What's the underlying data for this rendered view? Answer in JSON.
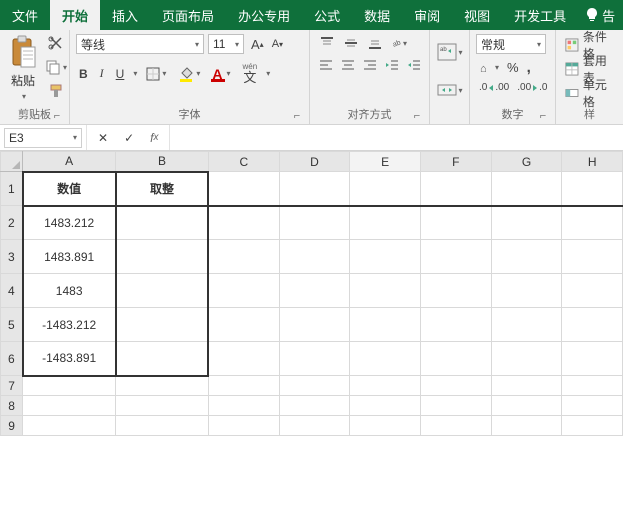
{
  "tabs": {
    "items": [
      "文件",
      "开始",
      "插入",
      "页面布局",
      "办公专用",
      "公式",
      "数据",
      "审阅",
      "视图",
      "开发工具"
    ],
    "active_index": 1,
    "tell_me_label": "告"
  },
  "ribbon": {
    "clipboard": {
      "paste_label": "粘贴",
      "group_label": "剪贴板"
    },
    "font": {
      "group_label": "字体",
      "font_name": "等线",
      "font_size": "11",
      "bold": "B",
      "italic": "I",
      "underline": "U",
      "wen_label": "wén",
      "wen_char": "文"
    },
    "align": {
      "group_label": "对齐方式"
    },
    "number": {
      "group_label": "数字",
      "format_name": "常规",
      "percent": "%",
      "comma": ","
    },
    "styles": {
      "group_label": "样",
      "cond_fmt": "条件格",
      "as_table": "套用表",
      "cell_style": "单元格"
    }
  },
  "formula_bar": {
    "name_box": "E3",
    "formula": ""
  },
  "sheet": {
    "columns": [
      "A",
      "B",
      "C",
      "D",
      "E",
      "F",
      "G",
      "H"
    ],
    "row_headers": [
      "1",
      "2",
      "3",
      "4",
      "5",
      "6",
      "7",
      "8",
      "9"
    ],
    "header_row": {
      "A": "数值",
      "B": "取整"
    },
    "data_rows": [
      {
        "A": "1483.212",
        "B": ""
      },
      {
        "A": "1483.891",
        "B": ""
      },
      {
        "A": "1483",
        "B": ""
      },
      {
        "A": "-1483.212",
        "B": ""
      },
      {
        "A": "-1483.891",
        "B": ""
      }
    ]
  }
}
